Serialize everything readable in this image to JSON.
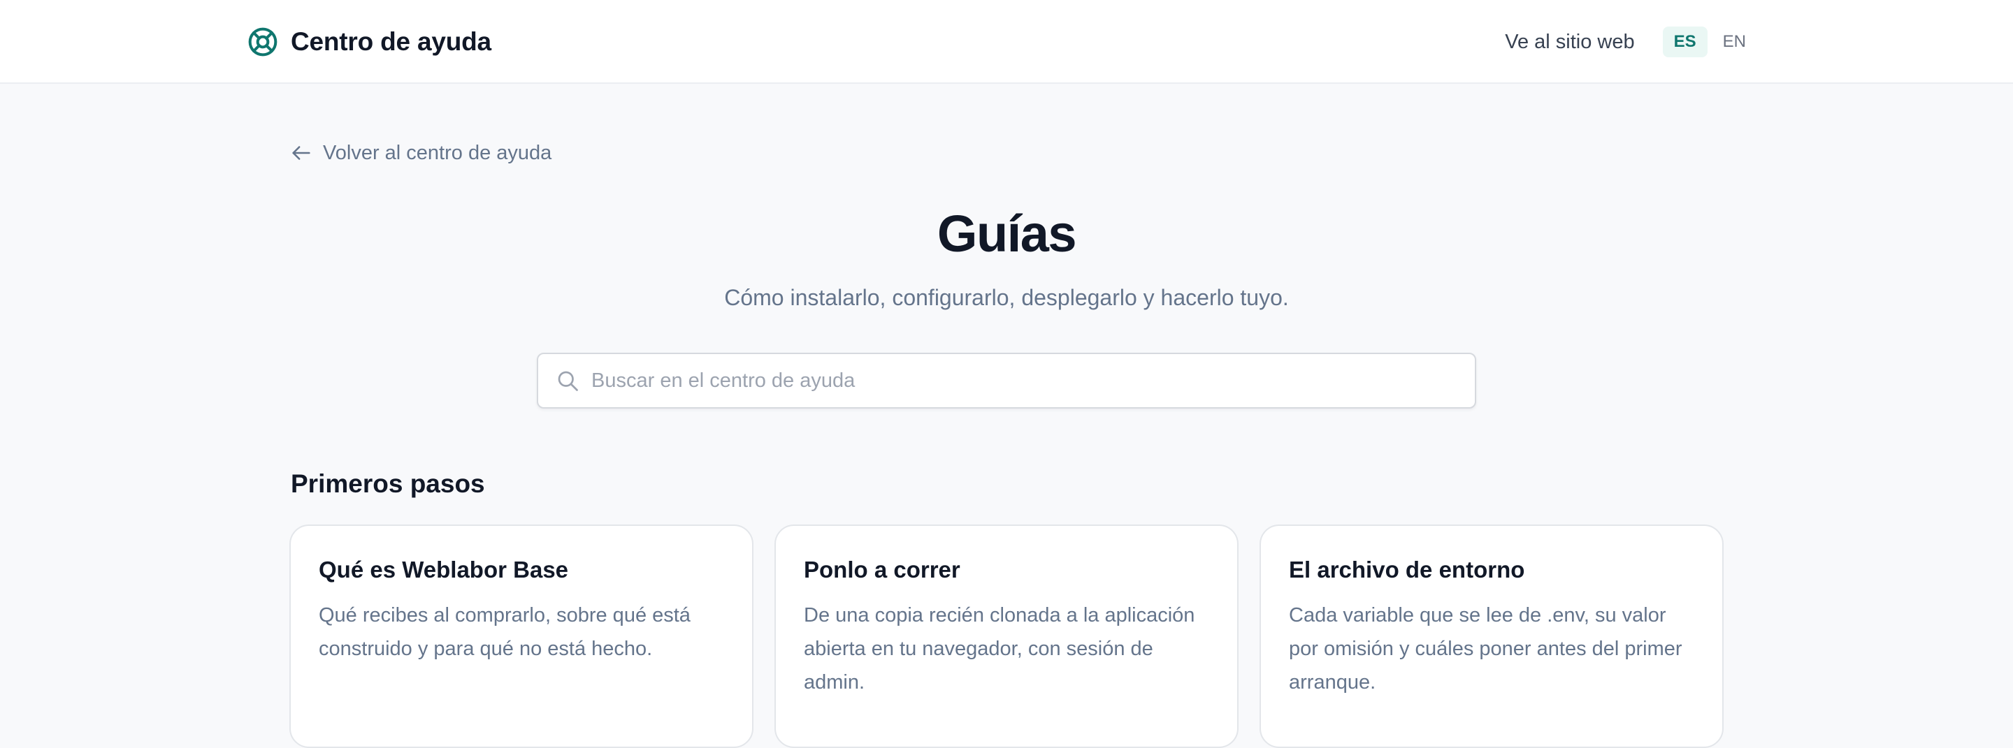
{
  "header": {
    "brand_title": "Centro de ayuda",
    "site_link": "Ve al sitio web",
    "languages": [
      {
        "label": "ES",
        "active": true
      },
      {
        "label": "EN",
        "active": false
      }
    ]
  },
  "icons": {
    "brand": "lifebuoy-icon",
    "back": "arrow-left-icon",
    "search": "search-icon"
  },
  "colors": {
    "accent": "#0f766e",
    "accent_bg": "#eaf7f4",
    "muted_text": "#64748b",
    "heading_text": "#111827",
    "page_bg": "#f8f9fb"
  },
  "back_link": "Volver al centro de ayuda",
  "page": {
    "title": "Guías",
    "subtitle": "Cómo instalarlo, configurarlo, desplegarlo y hacerlo tuyo."
  },
  "search": {
    "placeholder": "Buscar en el centro de ayuda",
    "value": ""
  },
  "section": {
    "title": "Primeros pasos",
    "cards": [
      {
        "title": "Qué es Weblabor Base",
        "description": "Qué recibes al comprarlo, sobre qué está construido y para qué no está hecho."
      },
      {
        "title": "Ponlo a correr",
        "description": "De una copia recién clonada a la aplicación abierta en tu navegador, con sesión de admin."
      },
      {
        "title": "El archivo de entorno",
        "description": "Cada variable que se lee de .env, su valor por omisión y cuáles poner antes del primer arranque."
      }
    ]
  }
}
